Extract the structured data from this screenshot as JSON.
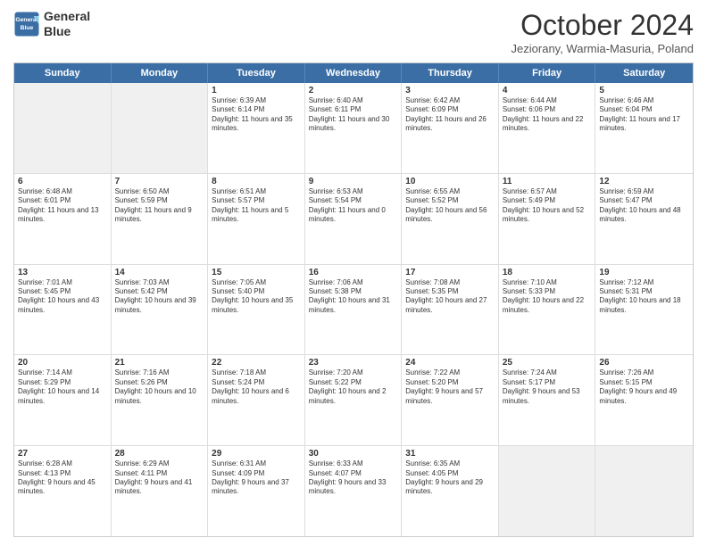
{
  "logo": {
    "line1": "General",
    "line2": "Blue"
  },
  "title": "October 2024",
  "subtitle": "Jeziorany, Warmia-Masuria, Poland",
  "days": [
    "Sunday",
    "Monday",
    "Tuesday",
    "Wednesday",
    "Thursday",
    "Friday",
    "Saturday"
  ],
  "rows": [
    [
      {
        "day": "",
        "content": ""
      },
      {
        "day": "",
        "content": ""
      },
      {
        "day": "1",
        "content": "Sunrise: 6:39 AM\nSunset: 6:14 PM\nDaylight: 11 hours and 35 minutes."
      },
      {
        "day": "2",
        "content": "Sunrise: 6:40 AM\nSunset: 6:11 PM\nDaylight: 11 hours and 30 minutes."
      },
      {
        "day": "3",
        "content": "Sunrise: 6:42 AM\nSunset: 6:09 PM\nDaylight: 11 hours and 26 minutes."
      },
      {
        "day": "4",
        "content": "Sunrise: 6:44 AM\nSunset: 6:06 PM\nDaylight: 11 hours and 22 minutes."
      },
      {
        "day": "5",
        "content": "Sunrise: 6:46 AM\nSunset: 6:04 PM\nDaylight: 11 hours and 17 minutes."
      }
    ],
    [
      {
        "day": "6",
        "content": "Sunrise: 6:48 AM\nSunset: 6:01 PM\nDaylight: 11 hours and 13 minutes."
      },
      {
        "day": "7",
        "content": "Sunrise: 6:50 AM\nSunset: 5:59 PM\nDaylight: 11 hours and 9 minutes."
      },
      {
        "day": "8",
        "content": "Sunrise: 6:51 AM\nSunset: 5:57 PM\nDaylight: 11 hours and 5 minutes."
      },
      {
        "day": "9",
        "content": "Sunrise: 6:53 AM\nSunset: 5:54 PM\nDaylight: 11 hours and 0 minutes."
      },
      {
        "day": "10",
        "content": "Sunrise: 6:55 AM\nSunset: 5:52 PM\nDaylight: 10 hours and 56 minutes."
      },
      {
        "day": "11",
        "content": "Sunrise: 6:57 AM\nSunset: 5:49 PM\nDaylight: 10 hours and 52 minutes."
      },
      {
        "day": "12",
        "content": "Sunrise: 6:59 AM\nSunset: 5:47 PM\nDaylight: 10 hours and 48 minutes."
      }
    ],
    [
      {
        "day": "13",
        "content": "Sunrise: 7:01 AM\nSunset: 5:45 PM\nDaylight: 10 hours and 43 minutes."
      },
      {
        "day": "14",
        "content": "Sunrise: 7:03 AM\nSunset: 5:42 PM\nDaylight: 10 hours and 39 minutes."
      },
      {
        "day": "15",
        "content": "Sunrise: 7:05 AM\nSunset: 5:40 PM\nDaylight: 10 hours and 35 minutes."
      },
      {
        "day": "16",
        "content": "Sunrise: 7:06 AM\nSunset: 5:38 PM\nDaylight: 10 hours and 31 minutes."
      },
      {
        "day": "17",
        "content": "Sunrise: 7:08 AM\nSunset: 5:35 PM\nDaylight: 10 hours and 27 minutes."
      },
      {
        "day": "18",
        "content": "Sunrise: 7:10 AM\nSunset: 5:33 PM\nDaylight: 10 hours and 22 minutes."
      },
      {
        "day": "19",
        "content": "Sunrise: 7:12 AM\nSunset: 5:31 PM\nDaylight: 10 hours and 18 minutes."
      }
    ],
    [
      {
        "day": "20",
        "content": "Sunrise: 7:14 AM\nSunset: 5:29 PM\nDaylight: 10 hours and 14 minutes."
      },
      {
        "day": "21",
        "content": "Sunrise: 7:16 AM\nSunset: 5:26 PM\nDaylight: 10 hours and 10 minutes."
      },
      {
        "day": "22",
        "content": "Sunrise: 7:18 AM\nSunset: 5:24 PM\nDaylight: 10 hours and 6 minutes."
      },
      {
        "day": "23",
        "content": "Sunrise: 7:20 AM\nSunset: 5:22 PM\nDaylight: 10 hours and 2 minutes."
      },
      {
        "day": "24",
        "content": "Sunrise: 7:22 AM\nSunset: 5:20 PM\nDaylight: 9 hours and 57 minutes."
      },
      {
        "day": "25",
        "content": "Sunrise: 7:24 AM\nSunset: 5:17 PM\nDaylight: 9 hours and 53 minutes."
      },
      {
        "day": "26",
        "content": "Sunrise: 7:26 AM\nSunset: 5:15 PM\nDaylight: 9 hours and 49 minutes."
      }
    ],
    [
      {
        "day": "27",
        "content": "Sunrise: 6:28 AM\nSunset: 4:13 PM\nDaylight: 9 hours and 45 minutes."
      },
      {
        "day": "28",
        "content": "Sunrise: 6:29 AM\nSunset: 4:11 PM\nDaylight: 9 hours and 41 minutes."
      },
      {
        "day": "29",
        "content": "Sunrise: 6:31 AM\nSunset: 4:09 PM\nDaylight: 9 hours and 37 minutes."
      },
      {
        "day": "30",
        "content": "Sunrise: 6:33 AM\nSunset: 4:07 PM\nDaylight: 9 hours and 33 minutes."
      },
      {
        "day": "31",
        "content": "Sunrise: 6:35 AM\nSunset: 4:05 PM\nDaylight: 9 hours and 29 minutes."
      },
      {
        "day": "",
        "content": ""
      },
      {
        "day": "",
        "content": ""
      }
    ]
  ]
}
